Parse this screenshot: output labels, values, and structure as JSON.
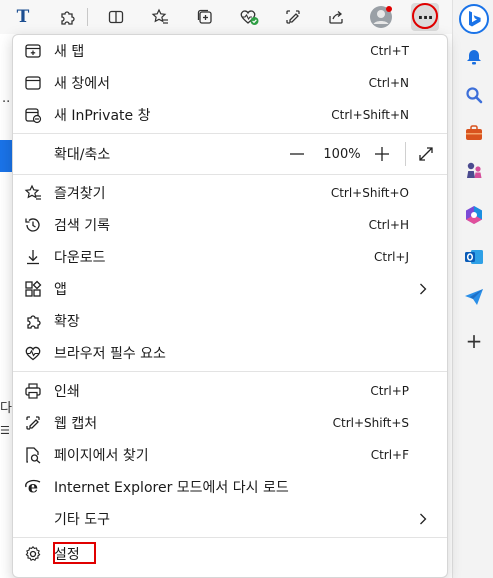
{
  "colors": {
    "accent_red": "#e00000",
    "edge_blue": "#1a73e8",
    "text": "#1b1b1b"
  },
  "toolbar": {
    "buttons": [
      {
        "name": "text-icon",
        "glyph": "T"
      },
      {
        "name": "extensions-icon"
      },
      {
        "name": "split-screen-icon"
      },
      {
        "name": "favorites-icon"
      },
      {
        "name": "collections-icon"
      },
      {
        "name": "browser-essentials-icon"
      },
      {
        "name": "web-capture-icon"
      },
      {
        "name": "share-icon"
      },
      {
        "name": "profile-avatar"
      },
      {
        "name": "more-icon",
        "glyph": "···"
      }
    ]
  },
  "sidebar": {
    "items": [
      "bing-icon",
      "notifications-icon",
      "search-icon",
      "shopping-icon",
      "games-icon",
      "office-icon",
      "outlook-icon",
      "send-icon",
      "add-icon"
    ],
    "add_glyph": "+"
  },
  "page_fragments": {
    "f1": "··",
    "f2": "다",
    "f3": "☰"
  },
  "menu": {
    "new_tab": {
      "label": "새 탭",
      "shortcut": "Ctrl+T"
    },
    "new_window": {
      "label": "새 창에서",
      "shortcut": "Ctrl+N"
    },
    "new_inprivate": {
      "label": "새 InPrivate 창",
      "shortcut": "Ctrl+Shift+N"
    },
    "zoom": {
      "label": "확대/축소",
      "minus": "—",
      "value": "100%",
      "plus": "+"
    },
    "favorites": {
      "label": "즐겨찾기",
      "shortcut": "Ctrl+Shift+O"
    },
    "history": {
      "label": "검색 기록",
      "shortcut": "Ctrl+H"
    },
    "downloads": {
      "label": "다운로드",
      "shortcut": "Ctrl+J"
    },
    "apps": {
      "label": "앱"
    },
    "extensions": {
      "label": "확장"
    },
    "essentials": {
      "label": "브라우저 필수 요소"
    },
    "print": {
      "label": "인쇄",
      "shortcut": "Ctrl+P"
    },
    "web_capture": {
      "label": "웹 캡처",
      "shortcut": "Ctrl+Shift+S"
    },
    "find": {
      "label": "페이지에서 찾기",
      "shortcut": "Ctrl+F"
    },
    "ie_mode": {
      "label": "Internet Explorer 모드에서 다시 로드"
    },
    "more_tools": {
      "label": "기타 도구"
    },
    "settings": {
      "label": "설정"
    }
  }
}
